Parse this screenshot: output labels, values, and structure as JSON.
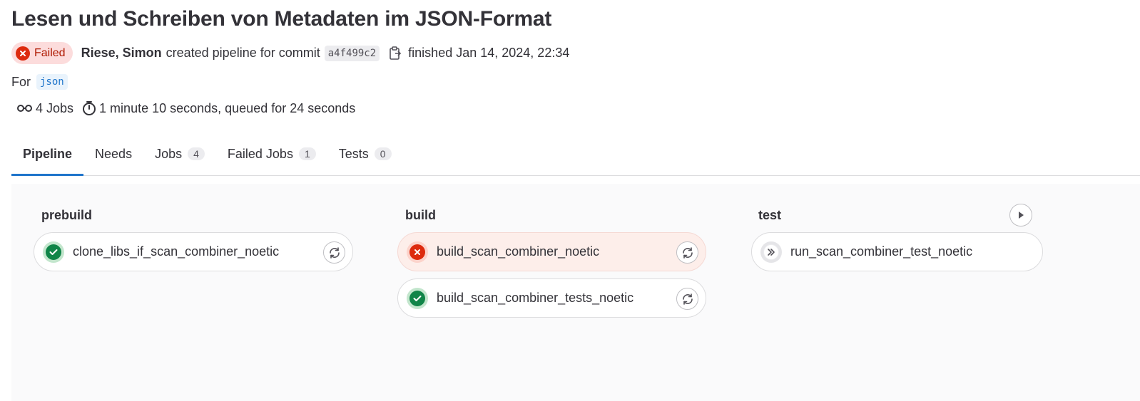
{
  "title": "Lesen und Schreiben von Metadaten im JSON-Format",
  "status_badge": "Failed",
  "author": "Riese, Simon",
  "created_text": "created pipeline for commit",
  "commit_sha": "a4f499c2",
  "finished_text": "finished Jan 14, 2024, 22:34",
  "for_text": "For",
  "ref": "json",
  "stats": {
    "jobs": "4 Jobs",
    "duration": "1 minute 10 seconds, queued for 24 seconds"
  },
  "tabs": [
    {
      "label": "Pipeline",
      "count": null
    },
    {
      "label": "Needs",
      "count": null
    },
    {
      "label": "Jobs",
      "count": "4"
    },
    {
      "label": "Failed Jobs",
      "count": "1"
    },
    {
      "label": "Tests",
      "count": "0"
    }
  ],
  "stages": [
    {
      "name": "prebuild",
      "jobs": [
        {
          "name": "clone_libs_if_scan_combiner_noetic",
          "status": "success"
        }
      ]
    },
    {
      "name": "build",
      "jobs": [
        {
          "name": "build_scan_combiner_noetic",
          "status": "failed"
        },
        {
          "name": "build_scan_combiner_tests_noetic",
          "status": "success"
        }
      ]
    },
    {
      "name": "test",
      "jobs": [
        {
          "name": "run_scan_combiner_test_noetic",
          "status": "skipped"
        }
      ]
    }
  ],
  "colors": {
    "failed": "#dd2b0e",
    "success": "#108548",
    "accent": "#1f75cb"
  }
}
